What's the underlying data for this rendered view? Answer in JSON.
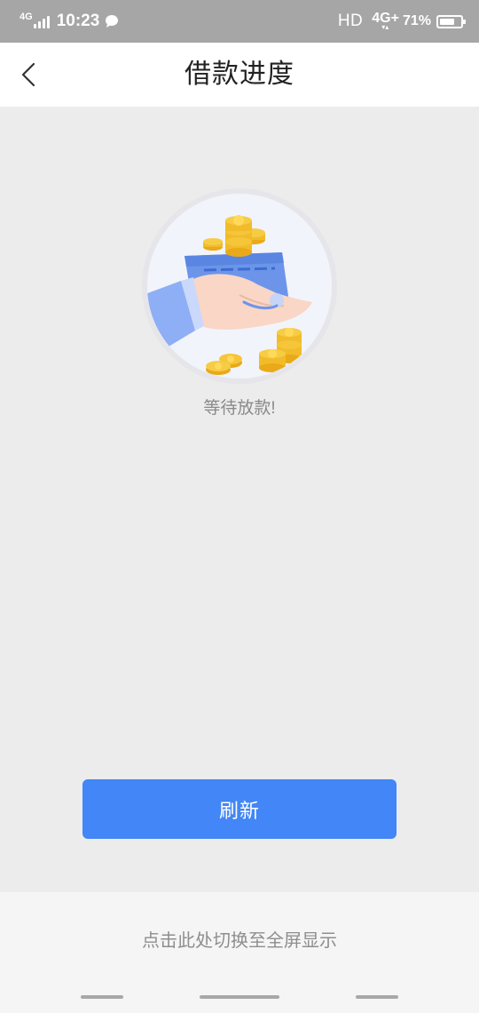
{
  "status_bar": {
    "network_left": "4G",
    "time": "10:23",
    "hd": "HD",
    "network_right": "4G+",
    "network_arrows": "▾▴",
    "battery_percent": "71%",
    "battery_level": 0.71,
    "icons": [
      "signal-icon",
      "chat-bubble-icon",
      "battery-icon"
    ]
  },
  "header": {
    "title": "借款进度",
    "back_icon": "chevron-left-icon"
  },
  "illustration": {
    "icon": "hand-card-coins-icon"
  },
  "main": {
    "status_text": "等待放款!",
    "refresh_label": "刷新",
    "accent_color": "#4286f7"
  },
  "footer": {
    "fullscreen_label": "点击此处切换至全屏显示"
  }
}
